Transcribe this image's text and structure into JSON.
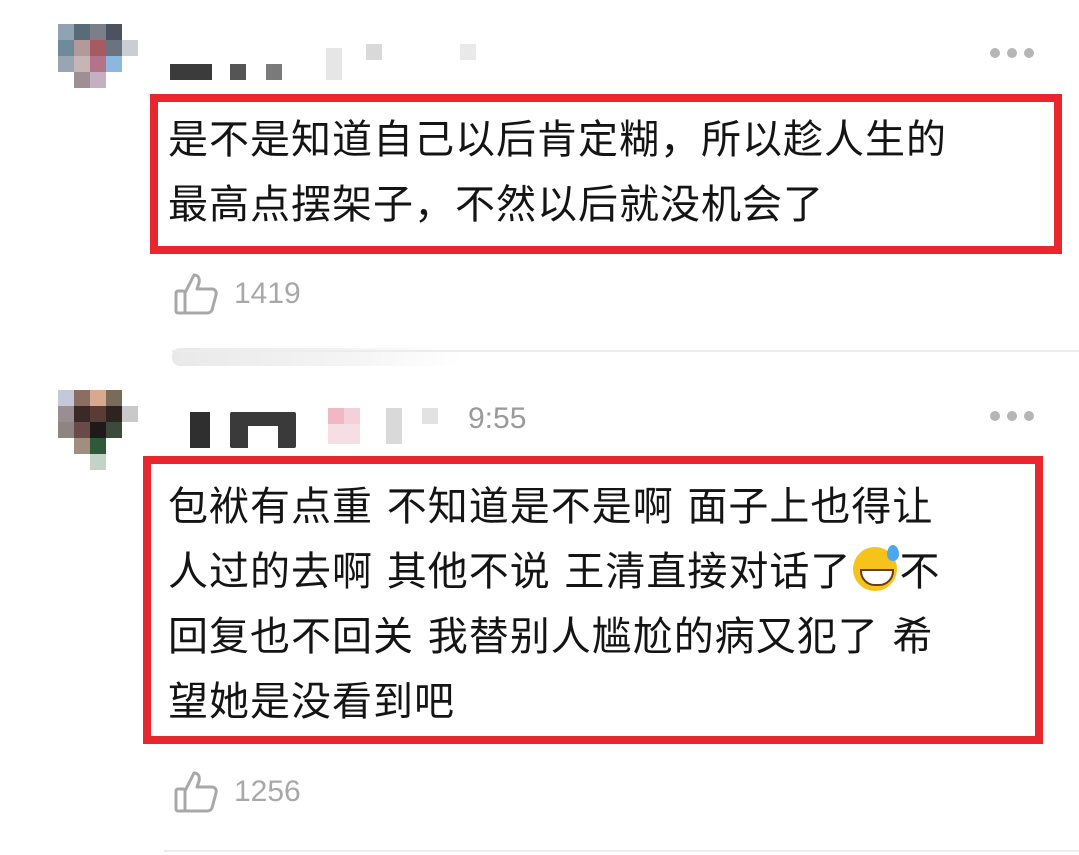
{
  "comments": [
    {
      "timestamp": "",
      "text_lines": [
        "是不是知道自己以后肯定糊，所以趁人生的",
        "最高点摆架子，不然以后就没机会了"
      ],
      "likes": "1419"
    },
    {
      "timestamp": "9:55",
      "text_lines": [
        "包袱有点重 不知道是不是啊 面子上也得让",
        "人过的去啊 其他不说 王清直接对话了",
        "不",
        "回复也不回关 我替别人尴尬的病又犯了 希",
        "望她是没看到吧"
      ],
      "likes": "1256"
    }
  ],
  "icons": {
    "like": "thumbs-up-icon",
    "more": "more-dots-icon",
    "emoji": "grinning-sweat-emoji"
  },
  "colors": {
    "highlight": "#e8262e",
    "meta_text": "#a8a8a8"
  }
}
